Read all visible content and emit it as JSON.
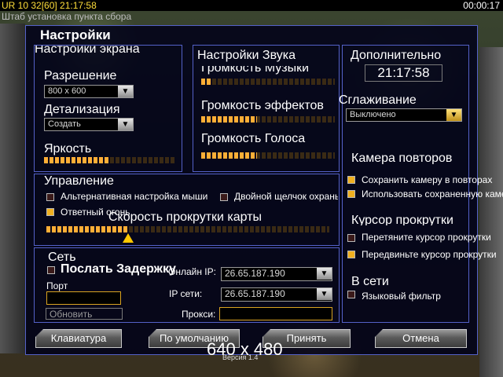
{
  "topbar": {
    "status": "UR 10 32[60] 21:17:58",
    "timer": "00:00:17",
    "subtitle": "Штаб установка пункта сбора"
  },
  "dialog": {
    "title": "Настройки"
  },
  "display": {
    "header": "Настройки экрана",
    "resolution_label": "Разрешение",
    "resolution_value": "800 x 600",
    "detail_label": "Детализация",
    "detail_value": "Создать",
    "brightness_label": "Яркость",
    "brightness_level": 0.5
  },
  "sound": {
    "header": "Настройки Звука",
    "sliders": [
      {
        "label": "Громкость Музыки",
        "level": 0.08
      },
      {
        "label": "Громкость эффектов",
        "level": 0.42
      },
      {
        "label": "Громкость Голоса",
        "level": 0.42
      }
    ]
  },
  "extra": {
    "header": "Дополнительно",
    "time": "21:17:58",
    "antialias_label": "Сглаживание",
    "antialias_value": "Выключено",
    "camera_header": "Камера повторов",
    "camera_opts": [
      {
        "label": "Сохранить камеру в повторах",
        "checked": true
      },
      {
        "label": "Использовать сохраненную камеру",
        "checked": true
      }
    ],
    "cursor_header": "Курсор прокрутки",
    "cursor_opts": [
      {
        "label": "Перетяните курсор прокрутки",
        "checked": false
      },
      {
        "label": "Передвиньте курсор прокрутки",
        "checked": true
      }
    ],
    "online_header": "В сети",
    "online_opts": [
      {
        "label": "Языковый фильтр",
        "checked": false
      }
    ]
  },
  "controls": {
    "header": "Управление",
    "opt_alt": "Альтернативная настройка мыши",
    "opt_dbl": "Двойной щелчок охраны",
    "opt_help": "Ответный огонь",
    "opt_alt_checked": false,
    "opt_dbl_checked": false,
    "opt_help_checked": true,
    "scroll_label": "Скорость прокрутки карты",
    "scroll_level": 0.29
  },
  "network": {
    "header": "Сеть",
    "send_delay_label": "Послать Задержку",
    "send_delay_checked": false,
    "port_label": "Порт",
    "port_value": "",
    "update_label": "Обновить",
    "online_ip_label": "Онлайн IP:",
    "online_ip_value": "26.65.187.190",
    "lan_ip_label": "IP сети:",
    "lan_ip_value": "26.65.187.190",
    "proxy_label": "Прокси:",
    "proxy_value": ""
  },
  "buttons": {
    "keyboard": "Клавиатура",
    "defaults": "По умолчанию",
    "accept": "Принять",
    "cancel": "Отмена"
  },
  "footer": {
    "resolution": "640 x 480",
    "version": "Версия 1.4"
  },
  "colors": {
    "panel_border": "#5461c8",
    "slider_on": "#ffae36",
    "checkbox_on": "#f0b020"
  }
}
